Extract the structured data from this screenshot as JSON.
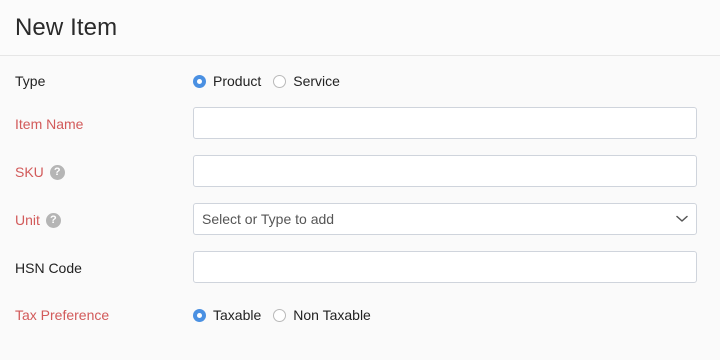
{
  "header": {
    "title": "New Item"
  },
  "form": {
    "type": {
      "label": "Type",
      "options": [
        {
          "label": "Product",
          "selected": true
        },
        {
          "label": "Service",
          "selected": false
        }
      ]
    },
    "item_name": {
      "label": "Item Name",
      "value": "",
      "required": true
    },
    "sku": {
      "label": "SKU",
      "value": "",
      "required": true,
      "help_icon": "question-icon"
    },
    "unit": {
      "label": "Unit",
      "placeholder": "Select or Type to add",
      "required": true,
      "help_icon": "question-icon"
    },
    "hsn_code": {
      "label": "HSN Code",
      "value": ""
    },
    "tax_preference": {
      "label": "Tax Preference",
      "required": true,
      "options": [
        {
          "label": "Taxable",
          "selected": true
        },
        {
          "label": "Non Taxable",
          "selected": false
        }
      ]
    }
  },
  "colors": {
    "required_label": "#d25a5a",
    "radio_selected": "#4a90e2",
    "border": "#cfd4dc"
  }
}
